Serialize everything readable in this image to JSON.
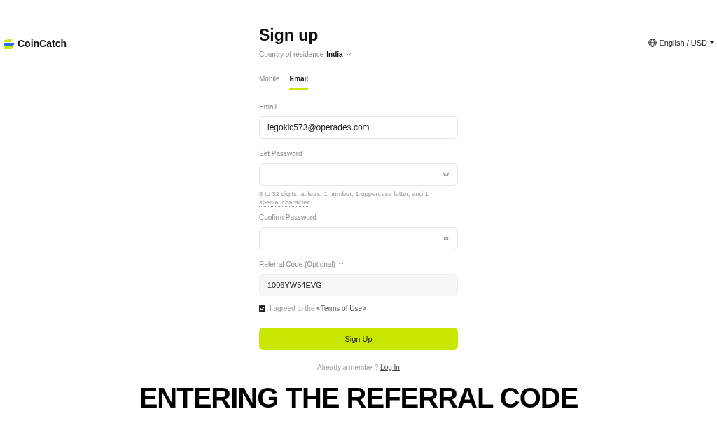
{
  "header": {
    "logo": "CoinCatch",
    "language": "English / USD"
  },
  "form": {
    "title": "Sign up",
    "country_label": "Country of residence",
    "country": "India",
    "tabs": [
      {
        "label": "Mobile",
        "selected": false
      },
      {
        "label": "Email",
        "selected": true
      }
    ],
    "email": {
      "label": "Email",
      "value": "legokic573@operades.com"
    },
    "password": {
      "label": "Set Password",
      "hint": "8 to 32 digits, at least 1 number, 1 uppercase letter, and 1",
      "hint_link": "special character"
    },
    "confirm": {
      "label": "Confirm Password"
    },
    "referral": {
      "label": "Referral Code (Optional)",
      "value": "1006YW54EVG"
    },
    "terms": {
      "checked": true,
      "text": "I agreed to the",
      "link": "<Terms of Use>"
    },
    "submit": "Sign Up",
    "login": {
      "text": "Already a member?",
      "link": "Log In"
    }
  },
  "caption": "ENTERING THE REFERRAL CODE"
}
